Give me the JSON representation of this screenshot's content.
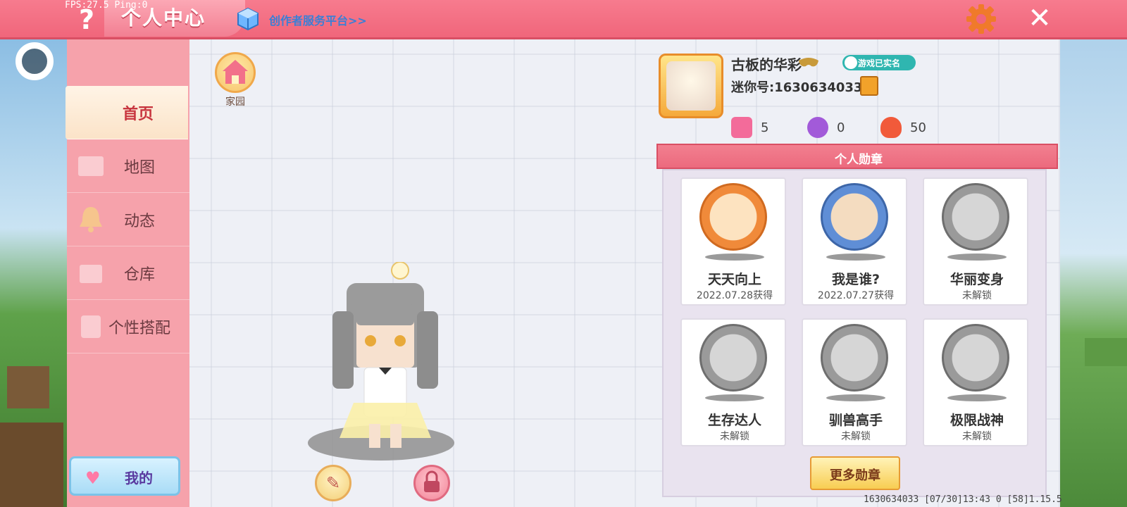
{
  "debug": {
    "fps_ping": "FPS:27.5  Ping:0"
  },
  "header": {
    "help_icon": "question-mark",
    "title": "个人中心",
    "creator_link": "创作者服务平台>>",
    "settings_icon": "gear-icon",
    "close_icon": "close-icon"
  },
  "sidebar": {
    "items": [
      {
        "label": "首页",
        "active": true
      },
      {
        "label": "地图",
        "active": false
      },
      {
        "label": "动态",
        "active": false
      },
      {
        "label": "仓库",
        "active": false
      },
      {
        "label": "个性搭配",
        "active": false
      }
    ],
    "mine_button": "我的"
  },
  "home": {
    "label": "家园"
  },
  "profile": {
    "nickname": "古板的华彩",
    "verified_label": "游戏已实名",
    "mini_id": "迷你号:1630634033",
    "stats": [
      {
        "icon": "star-book-icon",
        "value": "5",
        "color": "#f36b9a"
      },
      {
        "icon": "fan-icon",
        "value": "0",
        "color": "#a25ad9"
      },
      {
        "icon": "flame-icon",
        "value": "50",
        "color": "#f15a3a"
      }
    ]
  },
  "badges": {
    "title": "个人勋章",
    "items": [
      {
        "name": "天天向上",
        "status": "2022.07.28获得",
        "icon": "calendar-check-icon",
        "unlocked": true,
        "ring": "#f08a3a"
      },
      {
        "name": "我是谁?",
        "status": "2022.07.27获得",
        "icon": "id-card-icon",
        "unlocked": true,
        "ring": "#5f8ed6"
      },
      {
        "name": "华丽变身",
        "status": "未解锁",
        "icon": "dress-up-icon",
        "unlocked": false,
        "ring": "#9a9a9a"
      },
      {
        "name": "生存达人",
        "status": "未解锁",
        "icon": "campfire-icon",
        "unlocked": false,
        "ring": "#9a9a9a"
      },
      {
        "name": "驯兽高手",
        "status": "未解锁",
        "icon": "horse-icon",
        "unlocked": false,
        "ring": "#9a9a9a"
      },
      {
        "name": "极限战神",
        "status": "未解锁",
        "icon": "boss-icon",
        "unlocked": false,
        "ring": "#9a9a9a"
      }
    ],
    "more_button": "更多勋章"
  },
  "footer": {
    "info": "1630634033   [07/30]13:43 0  [58]1.15.5"
  },
  "colors": {
    "accent": "#f0667b",
    "sidebar": "#f6a2ab",
    "panel": "#eef0f6"
  }
}
